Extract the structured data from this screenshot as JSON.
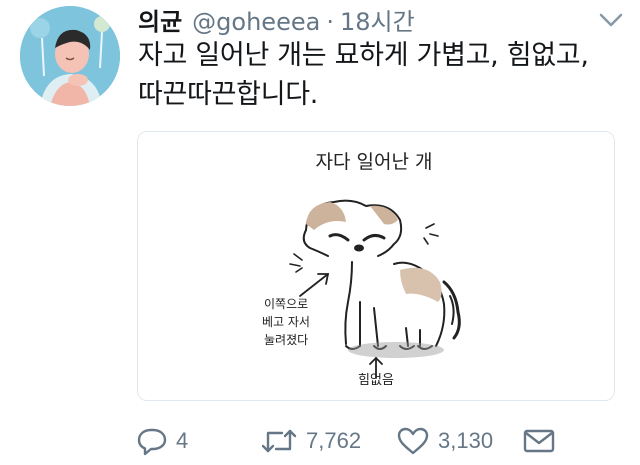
{
  "tweet": {
    "display_name": "의균",
    "handle": "@goheeea",
    "separator": "·",
    "time": "18시간",
    "text": "자고 일어난 개는 묘하게 가볍고, 힘없고, 따끈따끈합니다.",
    "image": {
      "title": "자다 일어난 개",
      "note_left": [
        "이쪽으로",
        "베고 자서",
        "눌려졌다"
      ],
      "note_bottom": "힘없음"
    },
    "actions": {
      "reply_count": "4",
      "retweet_count": "7,762",
      "like_count": "3,130"
    }
  },
  "colors": {
    "text": "#14171a",
    "muted": "#657786",
    "border": "#e1e8ed",
    "avatar_bg": "#7ec4dc"
  },
  "icons": {
    "menu": "chevron-down-icon",
    "reply": "reply-icon",
    "retweet": "retweet-icon",
    "like": "heart-icon",
    "dm": "envelope-icon"
  }
}
